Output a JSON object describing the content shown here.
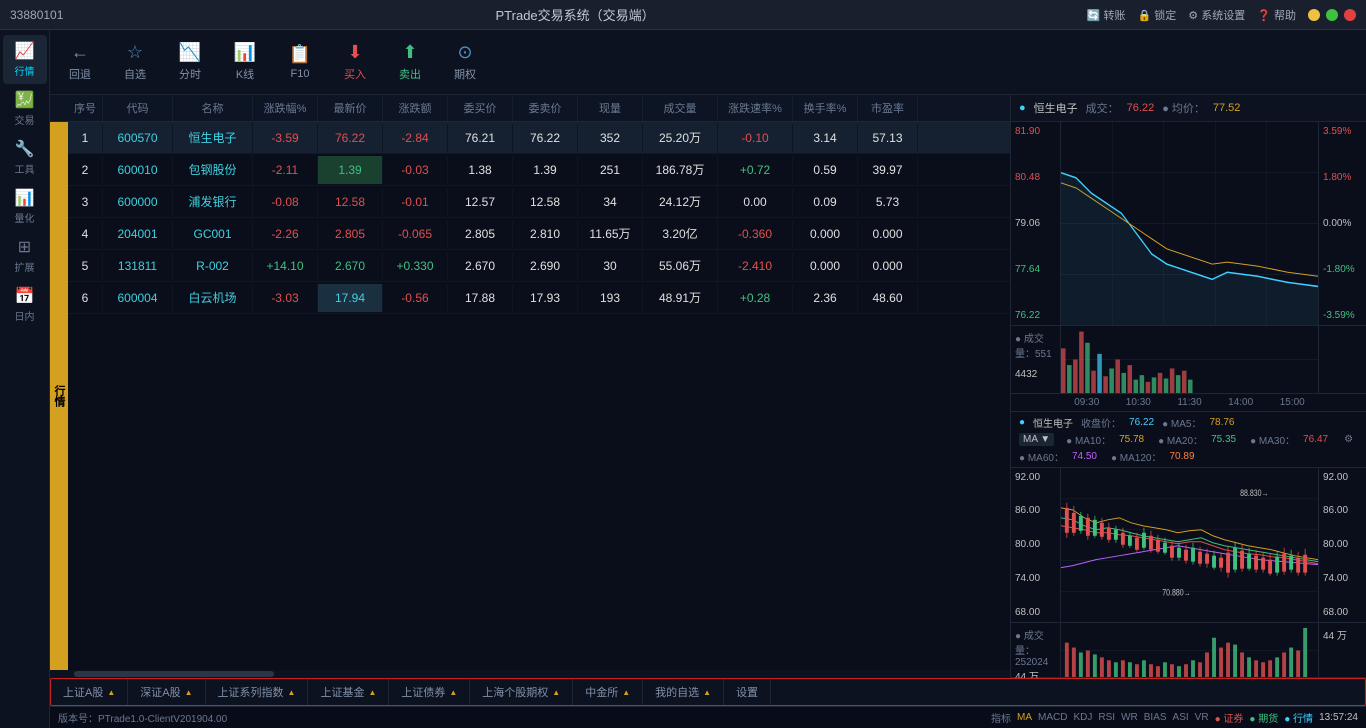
{
  "titleBar": {
    "appId": "33880101",
    "title": "PTrade交易系统（交易端）",
    "actions": [
      "转账",
      "锁定",
      "系统设置",
      "帮助"
    ]
  },
  "sidebar": {
    "items": [
      {
        "id": "market",
        "label": "行情",
        "icon": "📈",
        "active": true
      },
      {
        "id": "trade",
        "label": "交易",
        "icon": "💹"
      },
      {
        "id": "tools",
        "label": "工具",
        "icon": "🔧"
      },
      {
        "id": "quant",
        "label": "量化",
        "icon": "📊"
      },
      {
        "id": "expand",
        "label": "扩展",
        "icon": "⊞"
      },
      {
        "id": "dayinner",
        "label": "日内",
        "icon": "📅"
      }
    ]
  },
  "toolbar": {
    "back": "回退",
    "watchlist": "自选",
    "timeshare": "分时",
    "kline": "K线",
    "f10": "F10",
    "buy": "买入",
    "sell": "卖出",
    "options": "期权"
  },
  "tableHeaders": [
    "序号",
    "代码",
    "名称",
    "涨跌幅%",
    "最新价",
    "涨跌额",
    "委买价",
    "委卖价",
    "现量",
    "成交量",
    "涨跌速率%",
    "换手率%",
    "市盈率"
  ],
  "sideTab": "行情",
  "stocks": [
    {
      "seq": "1",
      "code": "600570",
      "name": "恒生电子",
      "pct": "-3.59",
      "price": "76.22",
      "change": "-2.84",
      "buy": "76.21",
      "sell": "76.22",
      "vol": "352",
      "amount": "25.20万",
      "speed": "-0.10",
      "turnover": "3.14",
      "pe": "57.13",
      "pctColor": "red",
      "priceColor": "red",
      "changeColor": "red",
      "speedColor": "red",
      "selected": true,
      "highlightPrice": false
    },
    {
      "seq": "2",
      "code": "600010",
      "name": "包钢股份",
      "pct": "-2.11",
      "price": "1.39",
      "change": "-0.03",
      "buy": "1.38",
      "sell": "1.39",
      "vol": "251",
      "amount": "186.78万",
      "speed": "+0.72",
      "turnover": "0.59",
      "pe": "39.97",
      "pctColor": "red",
      "priceColor": "green-bg",
      "changeColor": "red",
      "speedColor": "green"
    },
    {
      "seq": "3",
      "code": "600000",
      "name": "浦发银行",
      "pct": "-0.08",
      "price": "12.58",
      "change": "-0.01",
      "buy": "12.57",
      "sell": "12.58",
      "vol": "34",
      "amount": "24.12万",
      "speed": "0.00",
      "turnover": "0.09",
      "pe": "5.73",
      "pctColor": "red",
      "priceColor": "red",
      "changeColor": "red",
      "speedColor": "white"
    },
    {
      "seq": "4",
      "code": "204001",
      "name": "GC001",
      "pct": "-2.26",
      "price": "2.805",
      "change": "-0.065",
      "buy": "2.805",
      "sell": "2.810",
      "vol": "11.65万",
      "amount": "3.20亿",
      "speed": "-0.360",
      "turnover": "0.000",
      "pe": "0.000",
      "pctColor": "red",
      "priceColor": "red",
      "changeColor": "red",
      "speedColor": "red"
    },
    {
      "seq": "5",
      "code": "131811",
      "name": "R-002",
      "pct": "+14.10",
      "price": "2.670",
      "change": "+0.330",
      "buy": "2.670",
      "sell": "2.690",
      "vol": "30",
      "amount": "55.06万",
      "speed": "-2.410",
      "turnover": "0.000",
      "pe": "0.000",
      "pctColor": "green",
      "priceColor": "green",
      "changeColor": "green",
      "speedColor": "red"
    },
    {
      "seq": "6",
      "code": "600004",
      "name": "白云机场",
      "pct": "-3.03",
      "price": "17.94",
      "change": "-0.56",
      "buy": "17.88",
      "sell": "17.93",
      "vol": "193",
      "amount": "48.91万",
      "speed": "+0.28",
      "turnover": "2.36",
      "pe": "48.60",
      "pctColor": "red",
      "priceColor": "cyan-bg",
      "changeColor": "red",
      "speedColor": "green"
    }
  ],
  "chart": {
    "stockName": "恒生电子",
    "dealPrice": "76.22",
    "avgPrice": "77.52",
    "topPrice": "81.90",
    "price1": "80.48",
    "price2": "79.06",
    "price3": "77.64",
    "bottomPrice": "76.22",
    "pctRight": [
      "3.59%",
      "1.80%",
      "0.00%",
      "-1.80%",
      "-3.59%"
    ],
    "dealVol": "551",
    "maxVol": "4432",
    "times": [
      "09:30",
      "10:30",
      "11:30",
      "14:00",
      "15:00"
    ],
    "maIndicators": {
      "stock": "恒生电子",
      "closePrice": "76.22",
      "ma5": "78.76",
      "ma10": "75.78",
      "ma20": "75.35",
      "ma30": "76.47",
      "ma60": "74.50",
      "ma120": "70.89"
    },
    "kline": {
      "maxPrice": "92.00",
      "price1": "86.00",
      "price2": "80.00",
      "price3": "74.00",
      "price4": "68.00",
      "topArrow": "88.830→",
      "bottomArrow": "70.880→",
      "dealVol2": "252024",
      "maxVol2": "44万"
    }
  },
  "bottomTabs": [
    "上证A股",
    "深证A股",
    "上证系列指数",
    "上证基金",
    "上证债券",
    "上海个股期权",
    "中金所",
    "我的自选",
    "设置"
  ],
  "statusBar": {
    "version": "版本号：PTrade1.0-ClientV201904.00",
    "indicatorTabs": [
      "指标",
      "MA",
      "MACD",
      "KDJ",
      "RSI",
      "WR",
      "BIAS",
      "ASI",
      "VR"
    ],
    "legend": [
      "证券",
      "期货",
      "行情"
    ],
    "time": "13:57:24"
  }
}
